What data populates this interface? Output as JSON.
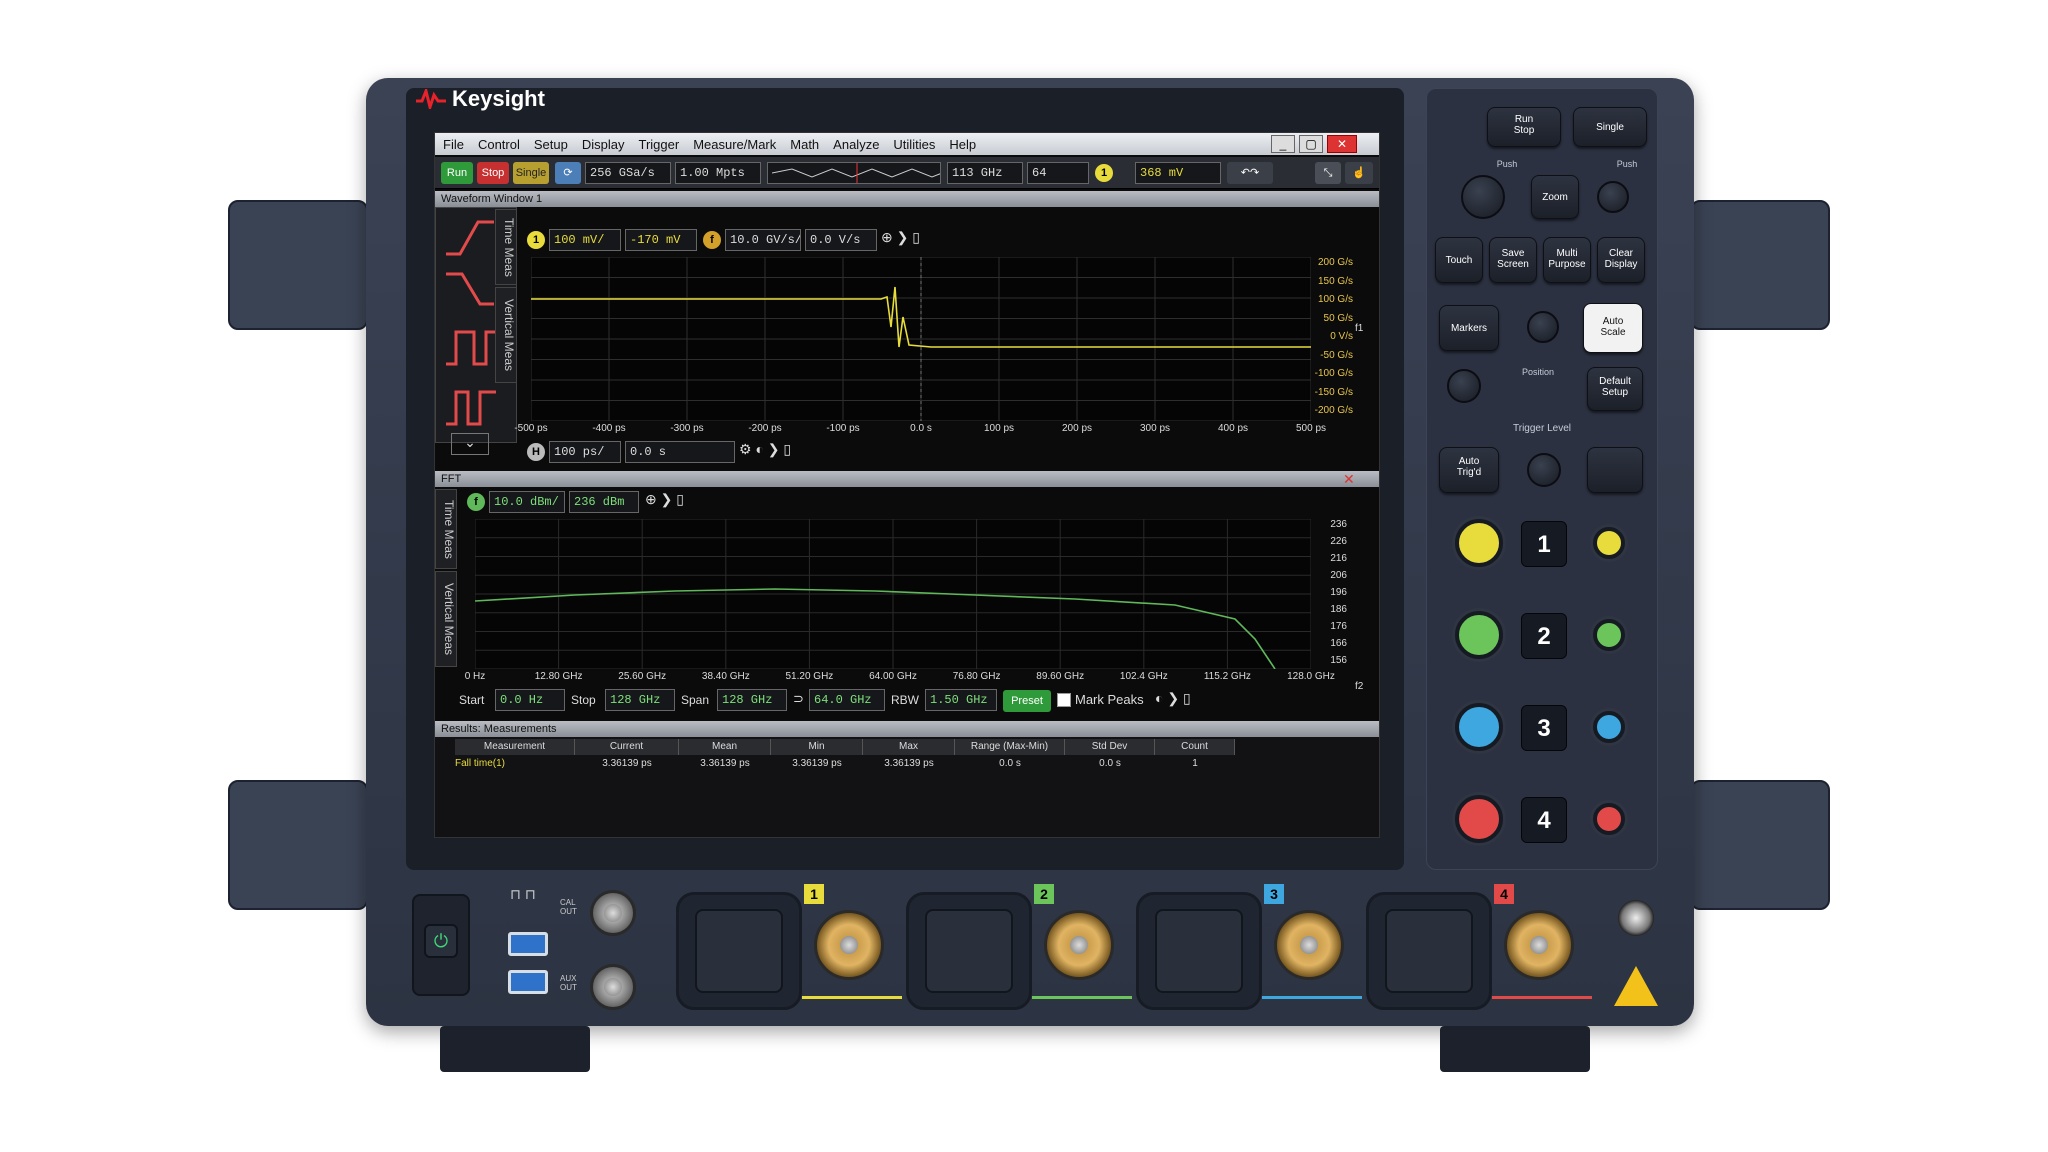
{
  "brand": "Keysight",
  "menu": {
    "items": [
      "File",
      "Control",
      "Setup",
      "Display",
      "Trigger",
      "Measure/Mark",
      "Math",
      "Analyze",
      "Utilities",
      "Help"
    ],
    "close": "✕"
  },
  "toolbar": {
    "run": "Run",
    "stop": "Stop",
    "single": "Single",
    "sample_rate": "256 GSa/s",
    "memory": "1.00 Mpts",
    "bandwidth": "113 GHz",
    "averages": "64",
    "trigger_level": "368 mV"
  },
  "waveform_window": {
    "title": "Waveform Window 1",
    "side_tabs": [
      "Time Meas",
      "Vertical Meas"
    ],
    "ch1_scale": "100 mV/",
    "ch1_offset": "-170 mV",
    "math_scale": "10.0 GV/s/",
    "math_offset": "0.0 V/s",
    "timebase": "100 ps/",
    "delay": "0.0 s",
    "x_ticks": [
      "-500 ps",
      "-400 ps",
      "-300 ps",
      "-200 ps",
      "-100 ps",
      "0.0 s",
      "100 ps",
      "200 ps",
      "300 ps",
      "400 ps",
      "500 ps"
    ],
    "y_ticks": [
      "200 G/s",
      "150 G/s",
      "100 G/s",
      "50 G/s",
      "0 V/s",
      "-50 G/s",
      "-100 G/s",
      "-150 G/s",
      "-200 G/s"
    ],
    "f1_label": "f1",
    "channel_color": "#e8dc3c"
  },
  "fft_window": {
    "title": "FFT",
    "side_tabs": [
      "Time Meas",
      "Vertical Meas"
    ],
    "scale": "10.0 dBm/",
    "offset": "236 dBm",
    "x_ticks": [
      "0 Hz",
      "12.80 GHz",
      "25.60 GHz",
      "38.40 GHz",
      "51.20 GHz",
      "64.00 GHz",
      "76.80 GHz",
      "89.60 GHz",
      "102.4 GHz",
      "115.2 GHz",
      "128.0 GHz"
    ],
    "y_ticks": [
      "236",
      "226",
      "216",
      "206",
      "196",
      "186",
      "176",
      "166",
      "156"
    ],
    "start_label": "Start",
    "start": "0.0 Hz",
    "stop_label": "Stop",
    "stop": "128 GHz",
    "span_label": "Span",
    "span": "128 GHz",
    "center": "64.0 GHz",
    "rbw_label": "RBW",
    "rbw": "1.50 GHz",
    "preset": "Preset",
    "mark_peaks": "Mark Peaks",
    "f2_label": "f2",
    "trace_color": "#5fb85a"
  },
  "results": {
    "title": "Results: Measurements",
    "columns": [
      "Measurement",
      "Current",
      "Mean",
      "Min",
      "Max",
      "Range (Max-Min)",
      "Std Dev",
      "Count"
    ],
    "rows": [
      [
        "Fall time(1)",
        "3.36139 ps",
        "3.36139 ps",
        "3.36139 ps",
        "3.36139 ps",
        "0.0 s",
        "0.0 s",
        "1"
      ]
    ]
  },
  "front_panel": {
    "run_stop": "Run\nStop",
    "single": "Single",
    "zoom": "Zoom",
    "touch": "Touch",
    "save_screen": "Save\nScreen",
    "multi_purpose": "Multi\nPurpose",
    "clear_display": "Clear\nDisplay",
    "markers": "Markers",
    "auto_scale": "Auto\nScale",
    "position": "Position",
    "default_setup": "Default\nSetup",
    "trigger_level": "Trigger Level",
    "auto_trig": "Auto\nTrig'd",
    "channels": [
      "1",
      "2",
      "3",
      "4"
    ],
    "channel_colors": [
      "#e8dc3c",
      "#6cc55a",
      "#3fa7e0",
      "#e24a4a"
    ],
    "push": "Push"
  },
  "lower_panel": {
    "cal_out": "CAL\nOUT",
    "aux_out": "AUX\nOUT",
    "channel_badges": [
      "1",
      "2",
      "3",
      "4"
    ]
  }
}
